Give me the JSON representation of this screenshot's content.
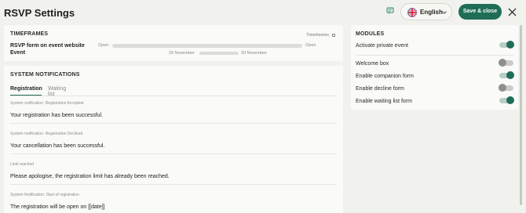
{
  "header": {
    "title": "RSVP Settings",
    "language": "English",
    "save_label": "Save & close",
    "accent": "#1f6d57"
  },
  "timeframes": {
    "title": "TIMEFRAMES",
    "link": "Timeframes",
    "row_label": "RSVP form on event website Event",
    "open_left": "Open",
    "open_right": "Open",
    "date_left": "20 November",
    "date_right": "20 November"
  },
  "notifications": {
    "title": "SYSTEM NOTIFICATIONS",
    "tabs": [
      {
        "label": "Registration",
        "active": true
      },
      {
        "label": "Waiting list",
        "active": false
      }
    ],
    "items": [
      {
        "caption": "System notification: Registration Accepted",
        "text": "Your registration has been successful."
      },
      {
        "caption": "System notification: Registration Declined",
        "text": "Your cancellation has been successful."
      },
      {
        "caption": "Limit reached",
        "text": "Please apologise, the registration limit has already been reached."
      },
      {
        "caption": "System Notification: Start of registration",
        "text": "The registration will be open on [[date]]"
      }
    ]
  },
  "modules": {
    "title": "MODULES",
    "items": [
      {
        "label": "Activate private event",
        "on": true
      },
      {
        "label": "Welcome box",
        "on": false
      },
      {
        "label": "Enable companion form",
        "on": true
      },
      {
        "label": "Enable decline form",
        "on": false
      },
      {
        "label": "Enable waiting list form",
        "on": true
      }
    ]
  }
}
